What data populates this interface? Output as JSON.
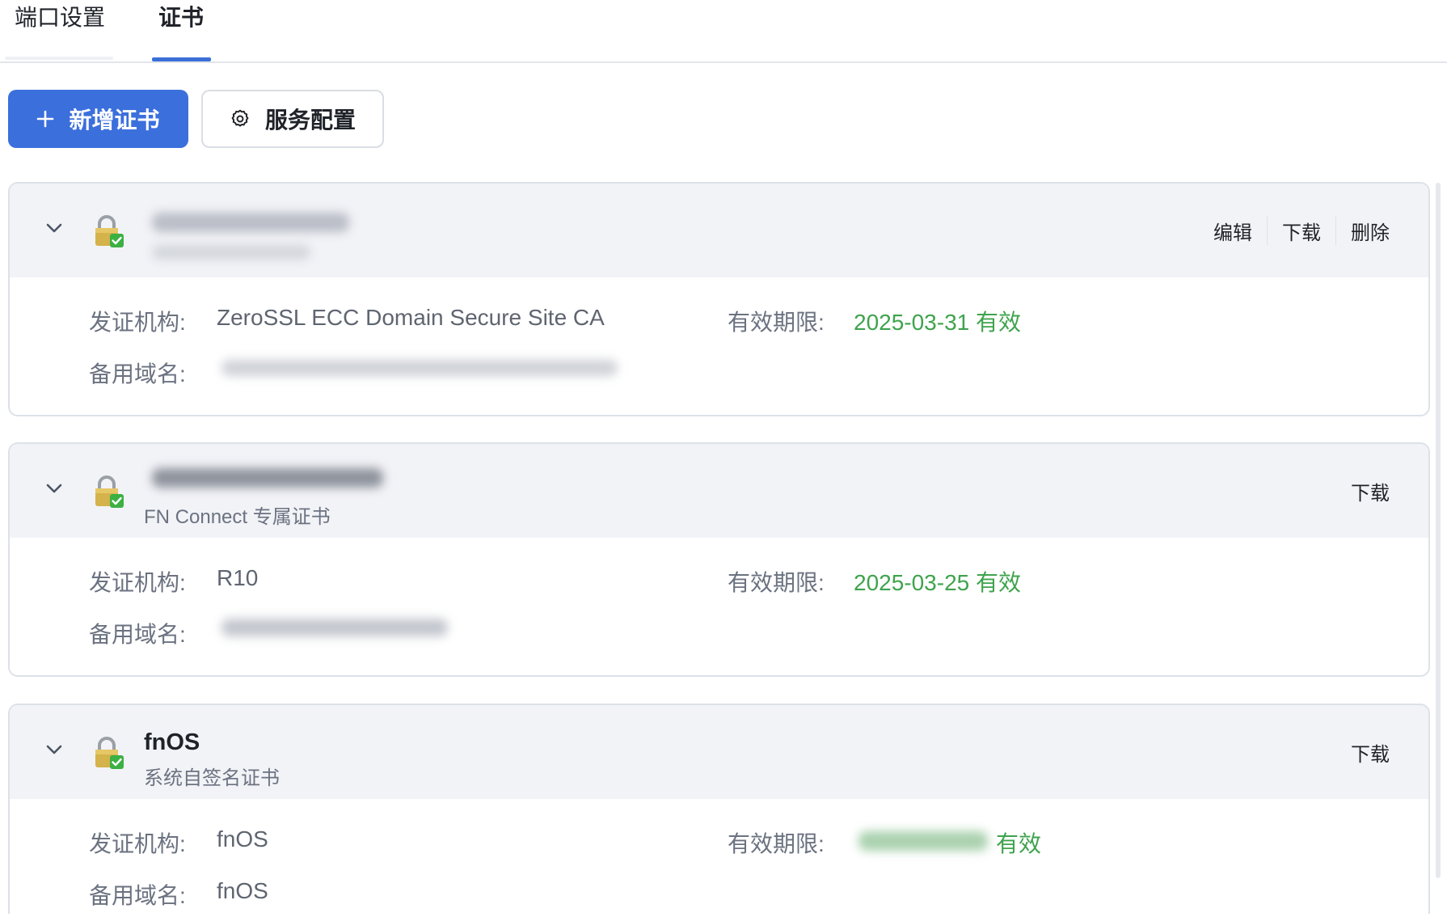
{
  "tabs": [
    {
      "label": "端口设置",
      "active": false
    },
    {
      "label": "证书",
      "active": true
    }
  ],
  "toolbar": {
    "add_label": "新增证书",
    "config_label": "服务配置"
  },
  "labels": {
    "issuer": "发证机构:",
    "expiry": "有效期限:",
    "alt_names": "备用域名:"
  },
  "certificates": [
    {
      "name": "",
      "subtitle": "",
      "actions": [
        "编辑",
        "下载",
        "删除"
      ],
      "issuer": "ZeroSSL ECC Domain Secure Site CA",
      "expiry": "2025-03-31 有效",
      "alt_names": ""
    },
    {
      "name": "",
      "subtitle": "FN Connect 专属证书",
      "actions": [
        "下载"
      ],
      "issuer": "R10",
      "expiry": "2025-03-25 有效",
      "alt_names": ""
    },
    {
      "name": "fnOS",
      "subtitle": "系统自签名证书",
      "actions": [
        "下载"
      ],
      "issuer": "fnOS",
      "expiry": "有效",
      "alt_names": "fnOS"
    }
  ],
  "colors": {
    "accent": "#3b6fdc",
    "valid_green": "#3fa34d",
    "card_header_bg": "#f2f3f7"
  }
}
